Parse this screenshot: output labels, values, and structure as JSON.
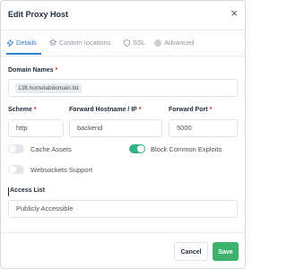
{
  "dialog": {
    "title": "Edit Proxy Host",
    "close_glyph": "×"
  },
  "tabs": [
    {
      "label": "Details",
      "icon": "bolt-icon",
      "active": true
    },
    {
      "label": "Custom locations",
      "icon": "layers-icon",
      "active": false
    },
    {
      "label": "SSL",
      "icon": "shield-icon",
      "active": false
    },
    {
      "label": "Advanced",
      "icon": "gear-icon",
      "active": false
    }
  ],
  "fields": {
    "domain_names": {
      "label": "Domain Names",
      "required_mark": "*",
      "value": "13ft.homelabdomain.tld"
    },
    "scheme": {
      "label": "Scheme",
      "required_mark": "*",
      "value": "http"
    },
    "forward_host": {
      "label": "Forward Hostname / IP",
      "required_mark": "*",
      "value": "backend"
    },
    "forward_port": {
      "label": "Forward Port",
      "required_mark": "*",
      "value": "5000"
    },
    "access_list": {
      "label": "Access List",
      "value": "Publicly Accessible"
    }
  },
  "toggles": {
    "cache_assets": {
      "label": "Cache Assets",
      "on": false
    },
    "block_common_exploits": {
      "label": "Block Common Exploits",
      "on": true
    },
    "websockets_support": {
      "label": "Websockets Support",
      "on": false
    }
  },
  "buttons": {
    "cancel": "Cancel",
    "save": "Save"
  },
  "colors": {
    "accent": "#2f7fd0",
    "toggle_on": "#2fb380",
    "save": "#3db26b",
    "required": "#cd201f"
  }
}
